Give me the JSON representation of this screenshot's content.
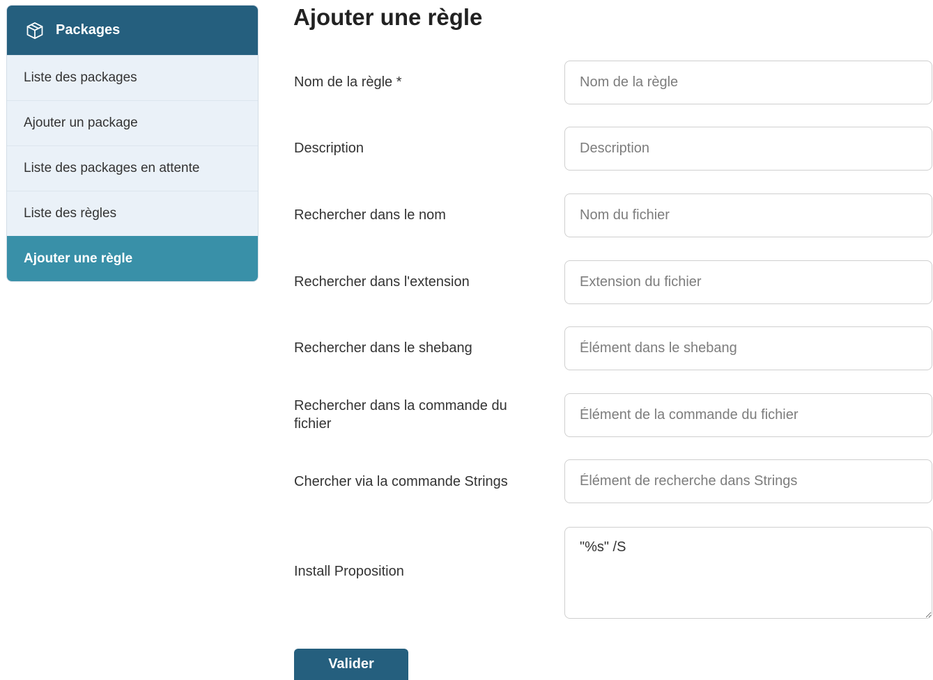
{
  "sidebar": {
    "header": {
      "icon": "package-box-icon",
      "title": "Packages"
    },
    "items": [
      {
        "label": "Liste des packages",
        "active": false
      },
      {
        "label": "Ajouter un package",
        "active": false
      },
      {
        "label": "Liste des packages en attente",
        "active": false
      },
      {
        "label": "Liste des règles",
        "active": false
      },
      {
        "label": "Ajouter une règle",
        "active": true
      }
    ]
  },
  "main": {
    "title": "Ajouter une règle",
    "form": {
      "fields": [
        {
          "label": "Nom de la règle *",
          "placeholder": "Nom de la règle",
          "value": ""
        },
        {
          "label": "Description",
          "placeholder": "Description",
          "value": ""
        },
        {
          "label": "Rechercher dans le nom",
          "placeholder": "Nom du fichier",
          "value": ""
        },
        {
          "label": "Rechercher dans l'extension",
          "placeholder": "Extension du fichier",
          "value": ""
        },
        {
          "label": "Rechercher dans le shebang",
          "placeholder": "Élément dans le shebang",
          "value": ""
        },
        {
          "label": "Rechercher dans la commande du fichier",
          "placeholder": "Élément de la commande du fichier",
          "value": ""
        },
        {
          "label": "Chercher via la commande Strings",
          "placeholder": "Élément de recherche dans Strings",
          "value": ""
        },
        {
          "label": "Install Proposition",
          "placeholder": "",
          "value": "\"%s\" /S"
        }
      ],
      "submit_label": "Valider"
    }
  },
  "colors": {
    "primary": "#255f7e",
    "active_item": "#3990a8",
    "sidebar_bg": "#eaf1f8"
  }
}
